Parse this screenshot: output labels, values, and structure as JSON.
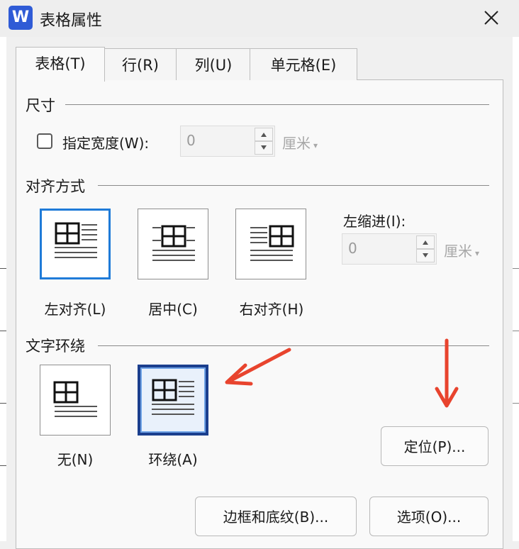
{
  "window": {
    "app_icon": "W",
    "title": "表格属性"
  },
  "tabs": [
    {
      "label": "表格(T)"
    },
    {
      "label": "行(R)"
    },
    {
      "label": "列(U)"
    },
    {
      "label": "单元格(E)"
    }
  ],
  "size": {
    "heading": "尺寸",
    "width_label": "指定宽度(W):",
    "width_value": "0",
    "width_unit": "厘米",
    "width_checked": false
  },
  "alignment": {
    "heading": "对齐方式",
    "options": [
      {
        "label": "左对齐(L)",
        "selected": true
      },
      {
        "label": "居中(C)",
        "selected": false
      },
      {
        "label": "右对齐(H)",
        "selected": false
      }
    ],
    "indent_label": "左缩进(I):",
    "indent_value": "0",
    "indent_unit": "厘米"
  },
  "wrapping": {
    "heading": "文字环绕",
    "options": [
      {
        "label": "无(N)",
        "selected": false
      },
      {
        "label": "环绕(A)",
        "selected": true
      }
    ],
    "position_button": "定位(P)..."
  },
  "footer": {
    "borders_button": "边框和底纹(B)...",
    "options_button": "选项(O)..."
  },
  "colors": {
    "annotation_arrow": "#e8442e",
    "selection_blue": "#1f7bd8"
  },
  "icons": [
    "word-app-icon",
    "close-icon",
    "spin-up-icon",
    "spin-down-icon",
    "dropdown-caret-icon",
    "table-align-left-icon",
    "table-align-center-icon",
    "table-align-right-icon",
    "wrap-none-icon",
    "wrap-around-icon",
    "red-arrow-annotation"
  ]
}
